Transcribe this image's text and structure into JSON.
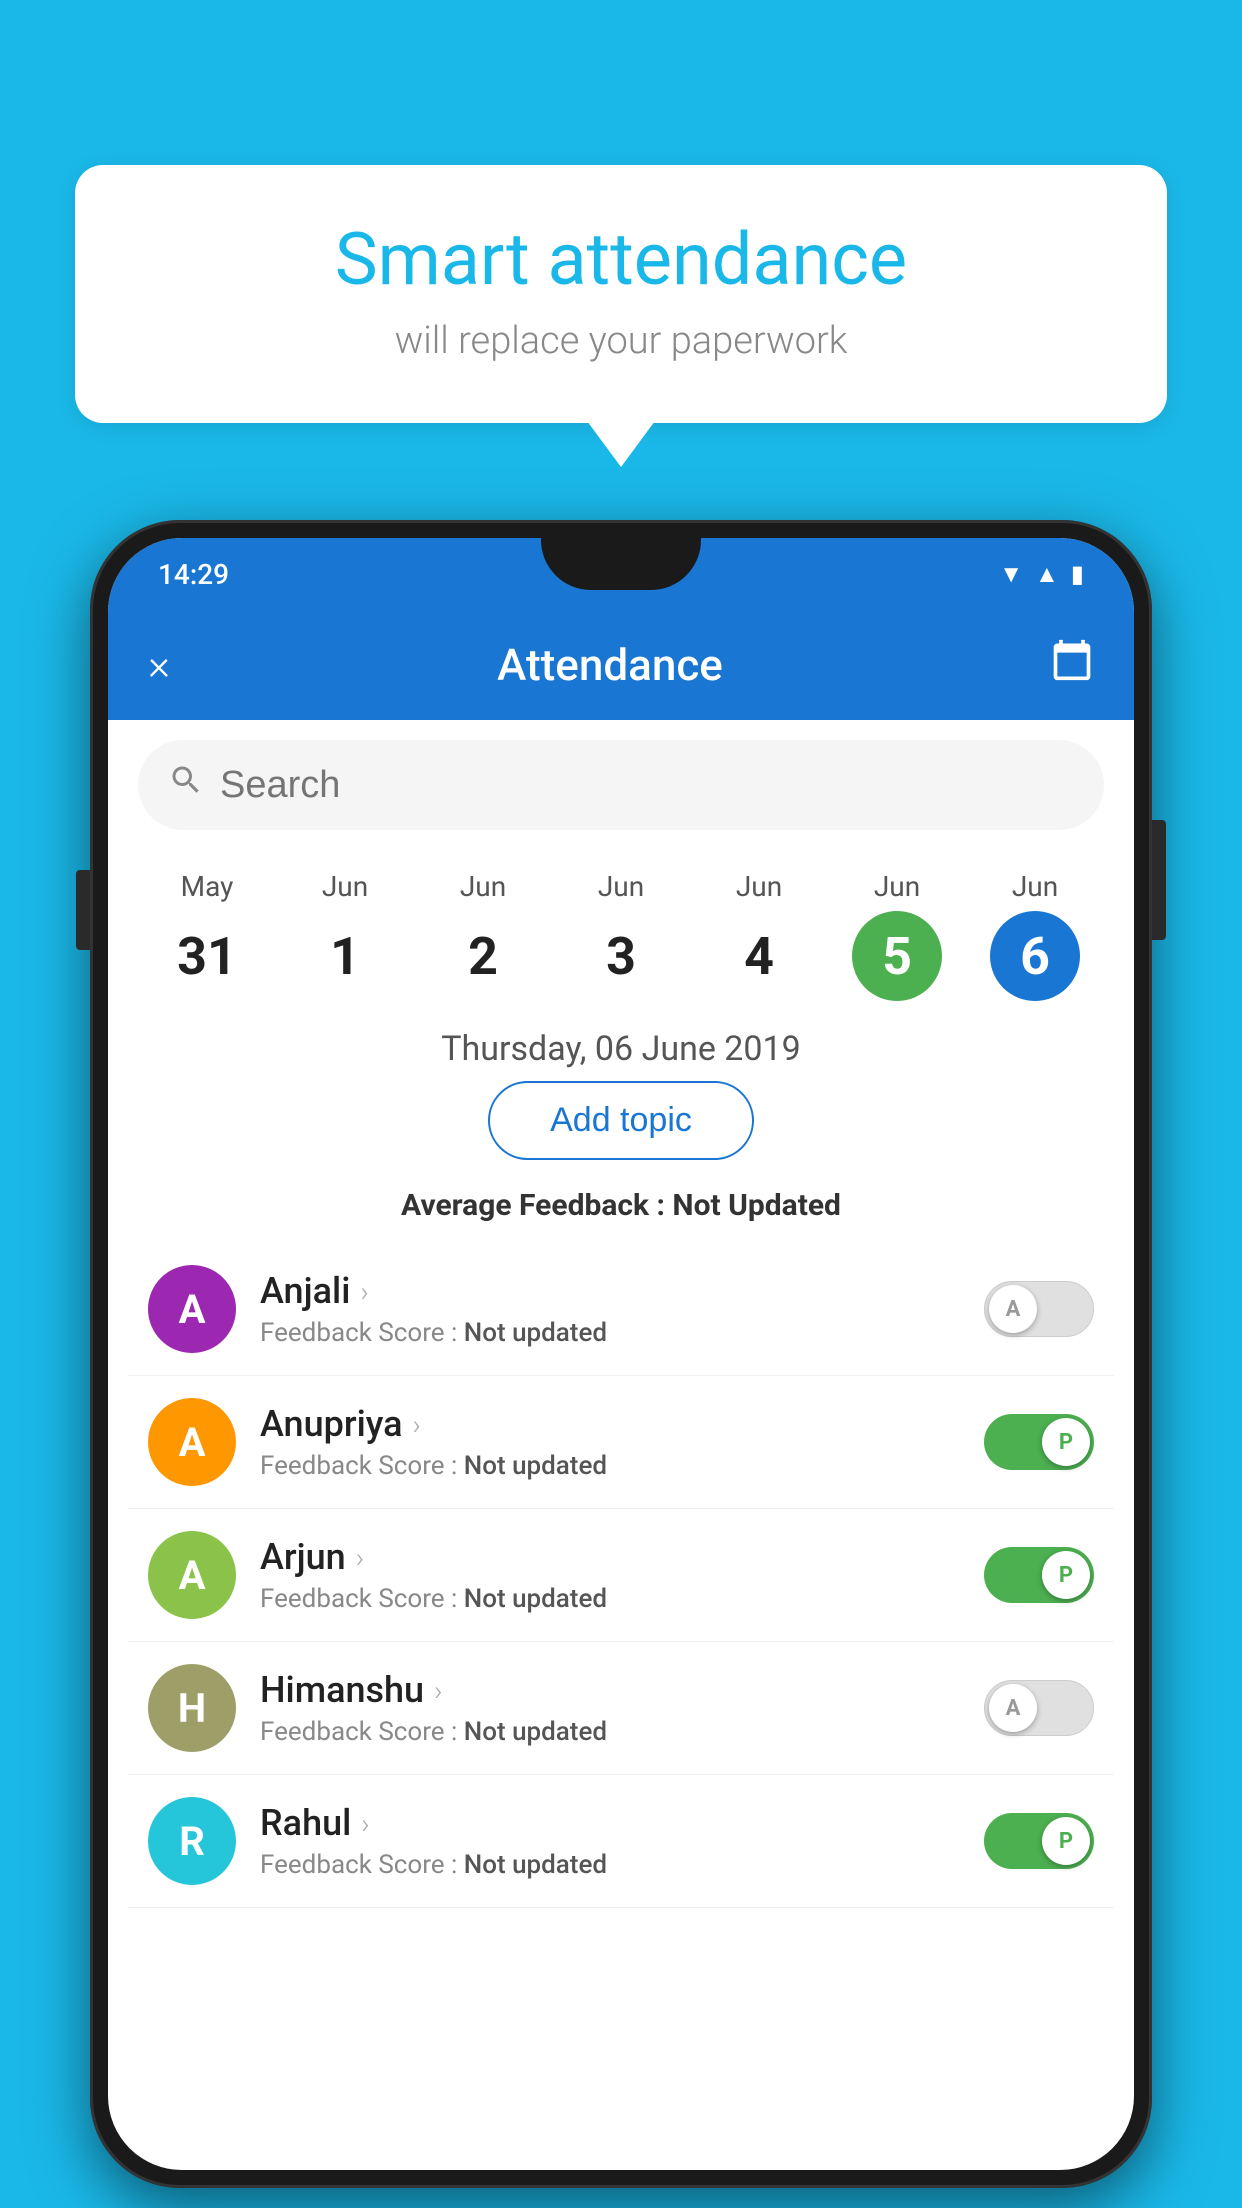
{
  "background_color": "#1ab8e8",
  "bubble": {
    "title": "Smart attendance",
    "subtitle": "will replace your paperwork"
  },
  "status_bar": {
    "time": "14:29"
  },
  "app_bar": {
    "title": "Attendance",
    "close_label": "×",
    "calendar_label": "📅"
  },
  "search": {
    "placeholder": "Search"
  },
  "calendar": {
    "days": [
      {
        "month": "May",
        "date": "31",
        "state": "normal"
      },
      {
        "month": "Jun",
        "date": "1",
        "state": "normal"
      },
      {
        "month": "Jun",
        "date": "2",
        "state": "normal"
      },
      {
        "month": "Jun",
        "date": "3",
        "state": "normal"
      },
      {
        "month": "Jun",
        "date": "4",
        "state": "normal"
      },
      {
        "month": "Jun",
        "date": "5",
        "state": "today"
      },
      {
        "month": "Jun",
        "date": "6",
        "state": "selected"
      }
    ]
  },
  "selected_date_label": "Thursday, 06 June 2019",
  "add_topic_label": "Add topic",
  "avg_feedback_label": "Average Feedback :",
  "avg_feedback_value": "Not Updated",
  "students": [
    {
      "name": "Anjali",
      "avatar_letter": "A",
      "avatar_color": "#9c27b0",
      "feedback_label": "Feedback Score :",
      "feedback_value": "Not updated",
      "toggle_state": "off",
      "toggle_label": "A"
    },
    {
      "name": "Anupriya",
      "avatar_letter": "A",
      "avatar_color": "#ff9800",
      "feedback_label": "Feedback Score :",
      "feedback_value": "Not updated",
      "toggle_state": "on",
      "toggle_label": "P"
    },
    {
      "name": "Arjun",
      "avatar_letter": "A",
      "avatar_color": "#8bc34a",
      "feedback_label": "Feedback Score :",
      "feedback_value": "Not updated",
      "toggle_state": "on",
      "toggle_label": "P"
    },
    {
      "name": "Himanshu",
      "avatar_letter": "H",
      "avatar_color": "#9e9e69",
      "feedback_label": "Feedback Score :",
      "feedback_value": "Not updated",
      "toggle_state": "off",
      "toggle_label": "A"
    },
    {
      "name": "Rahul",
      "avatar_letter": "R",
      "avatar_color": "#26c6da",
      "feedback_label": "Feedback Score :",
      "feedback_value": "Not updated",
      "toggle_state": "on",
      "toggle_label": "P"
    }
  ]
}
